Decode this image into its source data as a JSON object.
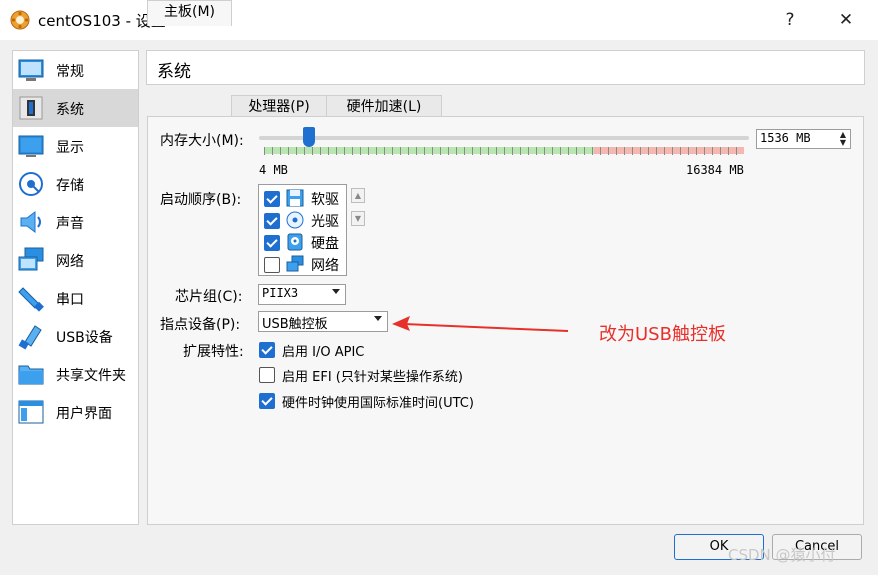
{
  "window": {
    "title": "centOS103 - 设置",
    "help": "?",
    "close": "✕"
  },
  "sidebar": {
    "items": [
      {
        "label": "常规",
        "icon": "monitor-icon"
      },
      {
        "label": "系统",
        "icon": "chip-icon"
      },
      {
        "label": "显示",
        "icon": "display-icon"
      },
      {
        "label": "存储",
        "icon": "disk-icon"
      },
      {
        "label": "声音",
        "icon": "speaker-icon"
      },
      {
        "label": "网络",
        "icon": "network-icon"
      },
      {
        "label": "串口",
        "icon": "serial-port-icon"
      },
      {
        "label": "USB设备",
        "icon": "usb-icon"
      },
      {
        "label": "共享文件夹",
        "icon": "folder-icon"
      },
      {
        "label": "用户界面",
        "icon": "window-icon"
      }
    ],
    "selected": "系统"
  },
  "header": {
    "title": "系统"
  },
  "tabs": [
    {
      "label": "主板(M)"
    },
    {
      "label": "处理器(P)"
    },
    {
      "label": "硬件加速(L)"
    }
  ],
  "motherboard": {
    "memory": {
      "label": "内存大小(M):",
      "value": "1536 MB",
      "min_label": "4 MB",
      "max_label": "16384 MB",
      "min_mb": 4,
      "max_mb": 16384,
      "current_mb": 1536
    },
    "boot_order": {
      "label": "启动顺序(B):",
      "items": [
        {
          "label": "软驱",
          "checked": true,
          "icon": "floppy-icon"
        },
        {
          "label": "光驱",
          "checked": true,
          "icon": "optical-drive-icon"
        },
        {
          "label": "硬盘",
          "checked": true,
          "icon": "hard-disk-icon"
        },
        {
          "label": "网络",
          "checked": false,
          "icon": "network-icon"
        }
      ]
    },
    "chipset": {
      "label": "芯片组(C):",
      "value": "PIIX3"
    },
    "pointing_device": {
      "label": "指点设备(P):",
      "value": "USB触控板"
    },
    "extended_features": {
      "label": "扩展特性:",
      "options": [
        {
          "label": "启用 I/O APIC",
          "checked": true
        },
        {
          "label": "启用 EFI (只针对某些操作系统)",
          "checked": false
        },
        {
          "label": "硬件时钟使用国际标准时间(UTC)",
          "checked": true
        }
      ]
    }
  },
  "annotation": {
    "text": "改为USB触控板",
    "color": "#e8302a"
  },
  "buttons": {
    "ok": "OK",
    "cancel": "Cancel"
  },
  "watermark": "CSDN @猿小付"
}
